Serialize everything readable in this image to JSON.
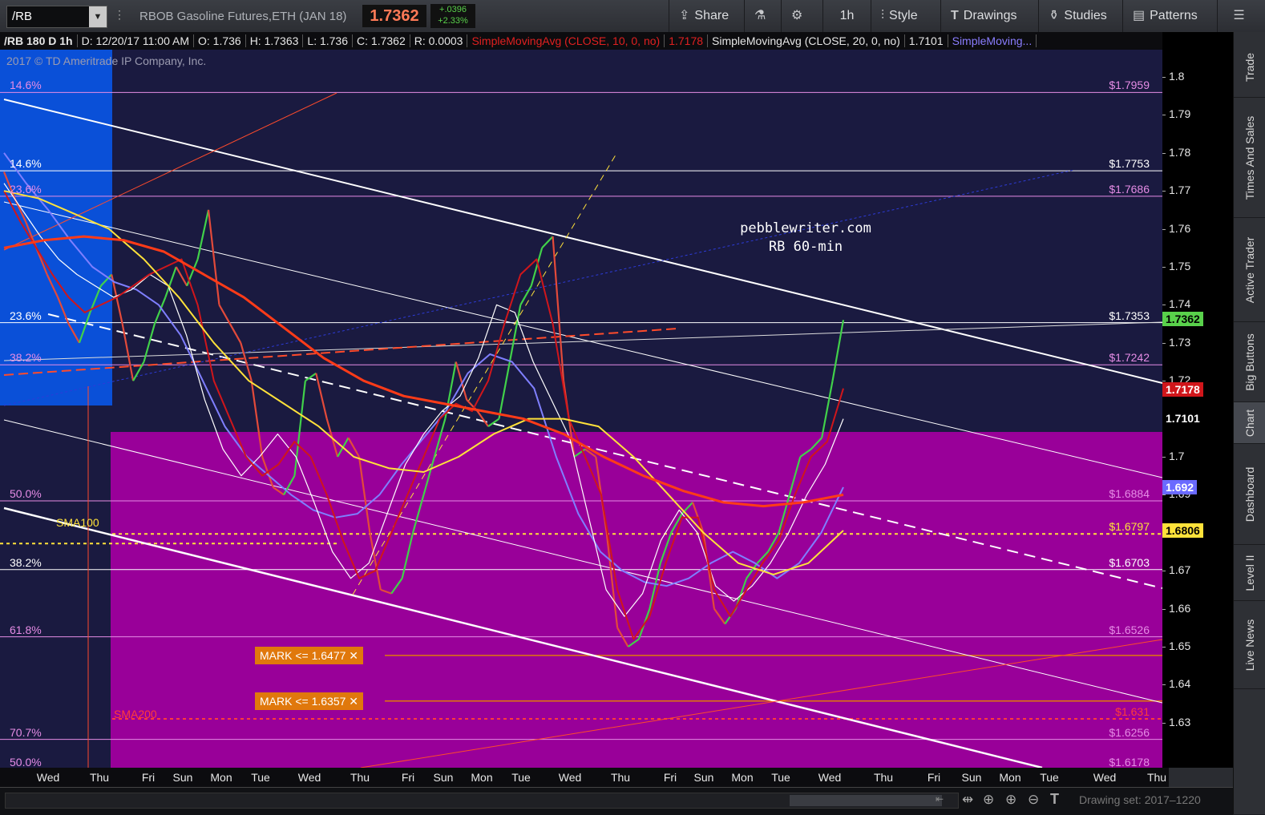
{
  "toolbar": {
    "symbol": "/RB",
    "instrument": "RBOB Gasoline Futures,ETH (JAN 18)",
    "last_price": "1.7362",
    "change_abs": "+.0396",
    "change_pct": "+2.33%",
    "share_label": "Share",
    "timeframe_label": "1h",
    "style_label": "Style",
    "drawings_label": "Drawings",
    "studies_label": "Studies",
    "patterns_label": "Patterns"
  },
  "info": {
    "series": "/RB 180 D 1h",
    "date": "D: 12/20/17 11:00 AM",
    "open": "O: 1.736",
    "high": "H: 1.7363",
    "low": "L: 1.736",
    "close": "C: 1.7362",
    "range": "R: 0.0003",
    "sma10_label": "SimpleMovingAvg (CLOSE, 10, 0, no)",
    "sma10_value": "1.7178",
    "sma20_label": "SimpleMovingAvg (CLOSE, 20, 0, no)",
    "sma20_value": "1.7101",
    "sma_more": "SimpleMoving..."
  },
  "chart": {
    "copyright": "2017 © TD Ameritrade IP Company, Inc.",
    "watermark_line1": "pebblewriter.com",
    "watermark_line2": "RB 60-min",
    "sma100_label": "SMA100",
    "sma200_label": "SMA200",
    "mark_orders": [
      {
        "label": "MARK <= 1.6477 ✕",
        "price": 1.6477
      },
      {
        "label": "MARK <= 1.6357 ✕",
        "price": 1.6357
      }
    ],
    "fib_left": [
      {
        "label": "14.6%",
        "price": 1.7959,
        "color": "#e58ce5"
      },
      {
        "label": "14.6%",
        "price": 1.7753,
        "color": "#ffffff"
      },
      {
        "label": "23.6%",
        "price": 1.7686,
        "color": "#e58ce5"
      },
      {
        "label": "23.6%",
        "price": 1.7353,
        "color": "#ffffff"
      },
      {
        "label": "38.2%",
        "price": 1.7242,
        "color": "#e58ce5"
      },
      {
        "label": "50.0%",
        "price": 1.6884,
        "color": "#e58ce5"
      },
      {
        "label": "38.2%",
        "price": 1.6703,
        "color": "#ffffff"
      },
      {
        "label": "61.8%",
        "price": 1.6526,
        "color": "#e58ce5"
      },
      {
        "label": "70.7%",
        "price": 1.6256,
        "color": "#e58ce5"
      },
      {
        "label": "50.0%",
        "price": 1.6178,
        "color": "#e58ce5"
      }
    ],
    "fib_right": [
      {
        "label": "$1.7959",
        "price": 1.7959,
        "color": "#e58ce5"
      },
      {
        "label": "$1.7753",
        "price": 1.7753,
        "color": "#ffffff"
      },
      {
        "label": "$1.7686",
        "price": 1.7686,
        "color": "#e58ce5"
      },
      {
        "label": "$1.7353",
        "price": 1.7353,
        "color": "#ffffff"
      },
      {
        "label": "$1.7242",
        "price": 1.7242,
        "color": "#e58ce5"
      },
      {
        "label": "$1.6884",
        "price": 1.6884,
        "color": "#e58ce5"
      },
      {
        "label": "$1.6797",
        "price": 1.6797,
        "color": "#ffe23a"
      },
      {
        "label": "$1.6703",
        "price": 1.6703,
        "color": "#ffffff"
      },
      {
        "label": "$1.6526",
        "price": 1.6526,
        "color": "#e58ce5"
      },
      {
        "label": "$1.631",
        "price": 1.631,
        "color": "#ff3b3b"
      },
      {
        "label": "$1.6256",
        "price": 1.6256,
        "color": "#e58ce5"
      },
      {
        "label": "$1.6178",
        "price": 1.6178,
        "color": "#e58ce5"
      }
    ]
  },
  "chart_data": {
    "type": "line",
    "title": "",
    "ylim": [
      1.618,
      1.81
    ],
    "y_ticks": [
      1.8,
      1.79,
      1.78,
      1.77,
      1.76,
      1.75,
      1.74,
      1.73,
      1.72,
      1.71,
      1.7,
      1.69,
      1.68,
      1.67,
      1.66,
      1.65,
      1.64,
      1.63
    ],
    "x_ticks": [
      "Wed",
      "Thu",
      "Fri",
      "Sun",
      "Mon",
      "Tue",
      "Wed",
      "Thu",
      "Fri",
      "Sun",
      "Mon",
      "Tue",
      "Wed",
      "Thu",
      "Fri",
      "Sun",
      "Mon",
      "Tue",
      "Wed",
      "Thu",
      "Fri",
      "Sun",
      "Mon",
      "Tue",
      "Wed",
      "Thu"
    ],
    "price_tags": [
      {
        "label": "1.7362",
        "price": 1.7362,
        "bg": "#59d14b",
        "fg": "#000000"
      },
      {
        "label": "1.7178",
        "price": 1.7178,
        "bg": "#d0161b",
        "fg": "#ffffff"
      },
      {
        "label": "1.7101",
        "price": 1.7101,
        "bg": "#000000",
        "fg": "#ffffff"
      },
      {
        "label": "1.692",
        "price": 1.692,
        "bg": "#6a6aff",
        "fg": "#ffffff"
      },
      {
        "label": "1.6806",
        "price": 1.6806,
        "bg": "#ffe23a",
        "fg": "#000000"
      }
    ],
    "series": [
      {
        "name": "SimpleMovingAvg (CLOSE, 10, 0, no)",
        "color": "#d0161b",
        "last": 1.7178
      },
      {
        "name": "SimpleMovingAvg (CLOSE, 20, 0, no)",
        "color": "#ffffff",
        "last": 1.7101
      },
      {
        "name": "SMA100",
        "color": "#ffe23a",
        "last": 1.6806
      },
      {
        "name": "SMA200",
        "color": "#ff3b3b",
        "last": 1.631
      }
    ],
    "close_path": [
      1.775,
      1.768,
      1.762,
      1.755,
      1.748,
      1.742,
      1.735,
      1.73,
      1.738,
      1.745,
      1.748,
      1.735,
      1.72,
      1.725,
      1.735,
      1.742,
      1.75,
      1.745,
      1.752,
      1.765,
      1.74,
      1.735,
      1.73,
      1.72,
      1.7,
      1.692,
      1.69,
      1.695,
      1.72,
      1.722,
      1.71,
      1.7,
      1.705,
      1.7,
      1.68,
      1.665,
      1.664,
      1.668,
      1.68,
      1.69,
      1.7,
      1.71,
      1.725,
      1.715,
      1.712,
      1.708,
      1.71,
      1.725,
      1.74,
      1.745,
      1.755,
      1.758,
      1.72,
      1.7,
      1.702,
      1.7,
      1.68,
      1.655,
      1.65,
      1.652,
      1.66,
      1.672,
      1.68,
      1.685,
      1.688,
      1.68,
      1.66,
      1.656,
      1.66,
      1.668,
      1.672,
      1.675,
      1.68,
      1.69,
      1.7,
      1.702,
      1.705,
      1.72,
      1.736
    ],
    "sma10_path": [
      1.77,
      1.762,
      1.755,
      1.748,
      1.742,
      1.738,
      1.74,
      1.742,
      1.745,
      1.748,
      1.75,
      1.752,
      1.74,
      1.72,
      1.71,
      1.7,
      1.695,
      1.698,
      1.704,
      1.7,
      1.69,
      1.678,
      1.668,
      1.67,
      1.68,
      1.69,
      1.7,
      1.71,
      1.714,
      1.712,
      1.72,
      1.735,
      1.748,
      1.752,
      1.735,
      1.71,
      1.7,
      1.69,
      1.665,
      1.652,
      1.658,
      1.672,
      1.684,
      1.684,
      1.665,
      1.658,
      1.665,
      1.672,
      1.678,
      1.69,
      1.7,
      1.704,
      1.718
    ],
    "sma20_path": [
      1.772,
      1.765,
      1.758,
      1.752,
      1.748,
      1.745,
      1.742,
      1.744,
      1.748,
      1.745,
      1.732,
      1.715,
      1.702,
      1.695,
      1.7,
      1.706,
      1.7,
      1.688,
      1.675,
      1.668,
      1.672,
      1.685,
      1.698,
      1.706,
      1.712,
      1.716,
      1.726,
      1.74,
      1.738,
      1.725,
      1.715,
      1.705,
      1.685,
      1.665,
      1.658,
      1.664,
      1.678,
      1.686,
      1.68,
      1.666,
      1.662,
      1.666,
      1.672,
      1.68,
      1.69,
      1.698,
      1.71
    ],
    "sma_blue_path": [
      1.78,
      1.772,
      1.765,
      1.757,
      1.75,
      1.746,
      1.744,
      1.74,
      1.732,
      1.72,
      1.708,
      1.7,
      1.695,
      1.69,
      1.686,
      1.684,
      1.685,
      1.69,
      1.698,
      1.705,
      1.712,
      1.722,
      1.727,
      1.725,
      1.718,
      1.7,
      1.685,
      1.675,
      1.67,
      1.667,
      1.666,
      1.668,
      1.672,
      1.675,
      1.672,
      1.668,
      1.672,
      1.68,
      1.692
    ],
    "sma100_path": [
      1.77,
      1.768,
      1.764,
      1.76,
      1.752,
      1.742,
      1.73,
      1.72,
      1.714,
      1.708,
      1.7,
      1.697,
      1.696,
      1.7,
      1.706,
      1.71,
      1.71,
      1.708,
      1.7,
      1.69,
      1.68,
      1.672,
      1.669,
      1.672,
      1.6806
    ],
    "sma200_path": [
      1.755,
      1.757,
      1.758,
      1.757,
      1.754,
      1.748,
      1.742,
      1.734,
      1.726,
      1.72,
      1.716,
      1.714,
      1.712,
      1.71,
      1.706,
      1.7,
      1.695,
      1.691,
      1.688,
      1.687,
      1.688,
      1.69
    ]
  },
  "rightbar": {
    "tabs": [
      "Trade",
      "Times And Sales",
      "Active Trader",
      "Big Buttons",
      "Chart",
      "Dashboard",
      "Level II",
      "Live News"
    ]
  },
  "bottombar": {
    "drawing_set": "Drawing set: 2017–1220"
  }
}
